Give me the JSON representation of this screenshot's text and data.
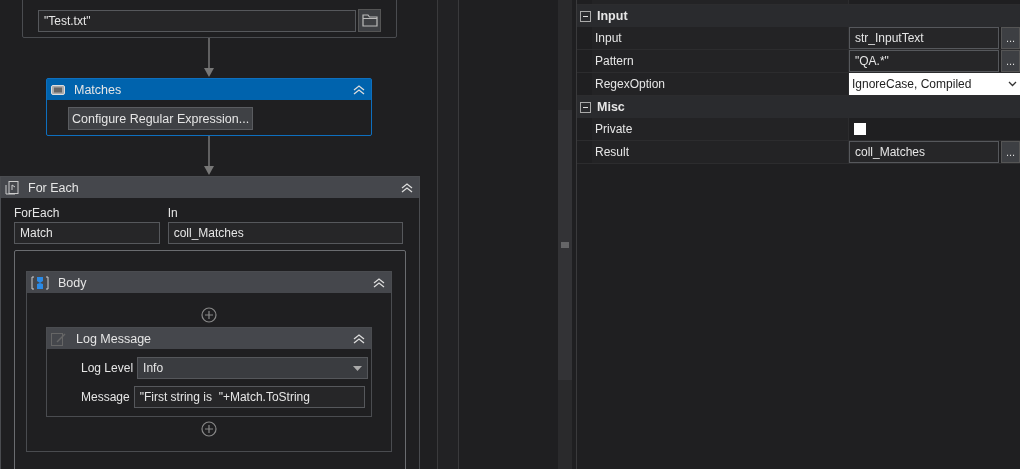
{
  "canvas": {
    "read_file": {
      "filename_value": "\"Test.txt\""
    },
    "matches": {
      "title": "Matches",
      "selected": true,
      "button": "Configure Regular Expression..."
    },
    "for_each": {
      "title": "For Each",
      "item_label": "ForEach",
      "item_value": "Match",
      "in_label": "In",
      "in_value": "coll_Matches",
      "body": {
        "title": "Body",
        "log_message": {
          "title": "Log Message",
          "level_label": "Log Level",
          "level_value": "Info",
          "message_label": "Message",
          "message_value": "\"First string is  \"+Match.ToString"
        }
      }
    }
  },
  "properties": {
    "categories": [
      {
        "title": "Input",
        "expanded": true,
        "rows": [
          {
            "kind": "text",
            "name": "Input",
            "value": "str_InputText",
            "button": "..."
          },
          {
            "kind": "text",
            "name": "Pattern",
            "value": "\"QA.*\"",
            "button": "..."
          },
          {
            "kind": "combo",
            "name": "RegexOption",
            "value": "IgnoreCase, Compiled"
          }
        ]
      },
      {
        "title": "Misc",
        "expanded": true,
        "rows": [
          {
            "kind": "checkbox",
            "name": "Private",
            "checked": false
          },
          {
            "kind": "text",
            "name": "Result",
            "value": "coll_Matches",
            "button": "..."
          }
        ]
      }
    ]
  }
}
